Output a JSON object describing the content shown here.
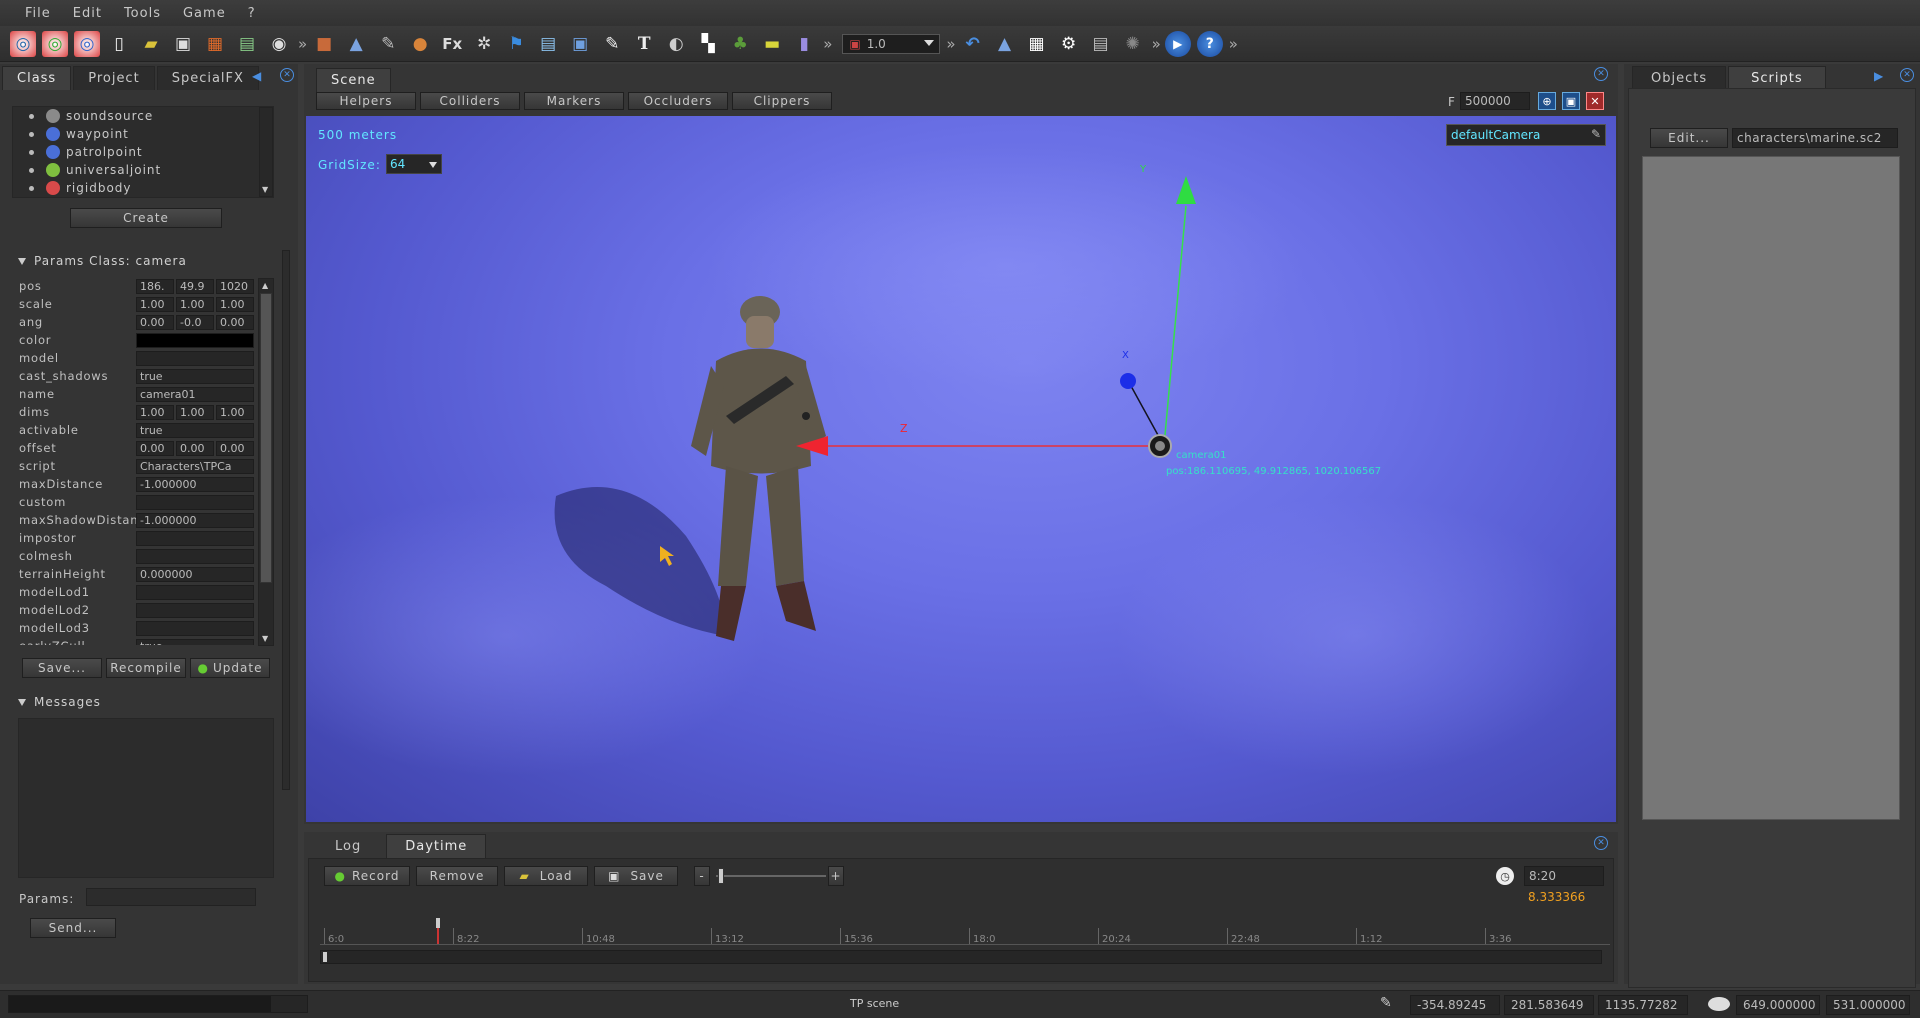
{
  "menu": [
    "File",
    "Edit",
    "Tools",
    "Game",
    "?"
  ],
  "toolbar": {
    "zoom_value": "1.0",
    "overflow": "»",
    "fx_label": "Fx",
    "text_tool": "T"
  },
  "left_panel": {
    "tabs": [
      "Class",
      "Project",
      "SpecialFX"
    ],
    "class_list": [
      {
        "label": "soundsource",
        "icon_color": "#8a8a8a"
      },
      {
        "label": "waypoint",
        "icon_color": "#4a6fd8"
      },
      {
        "label": "patrolpoint",
        "icon_color": "#4a6fd8"
      },
      {
        "label": "universaljoint",
        "icon_color": "#7fbf3f"
      },
      {
        "label": "rigidbody",
        "icon_color": "#d84a4a"
      }
    ],
    "create_label": "Create",
    "params_title": "Params Class:  camera",
    "params": [
      {
        "name": "pos",
        "v3": [
          "186.",
          "49.9",
          "1020"
        ]
      },
      {
        "name": "scale",
        "v3": [
          "1.00",
          "1.00",
          "1.00"
        ]
      },
      {
        "name": "ang",
        "v3": [
          "0.00",
          "-0.0",
          "0.00"
        ]
      },
      {
        "name": "color",
        "value": "",
        "black": true
      },
      {
        "name": "model",
        "value": ""
      },
      {
        "name": "cast_shadows",
        "value": "true"
      },
      {
        "name": "name",
        "value": "camera01"
      },
      {
        "name": "dims",
        "v3": [
          "1.00",
          "1.00",
          "1.00"
        ]
      },
      {
        "name": "activable",
        "value": "true"
      },
      {
        "name": "offset",
        "v3": [
          "0.00",
          "0.00",
          "0.00"
        ]
      },
      {
        "name": "script",
        "value": "Characters\\TPCa"
      },
      {
        "name": "maxDistance",
        "value": "-1.000000"
      },
      {
        "name": "custom",
        "value": ""
      },
      {
        "name": "maxShadowDistan",
        "value": "-1.000000"
      },
      {
        "name": "impostor",
        "value": ""
      },
      {
        "name": "colmesh",
        "value": ""
      },
      {
        "name": "terrainHeight",
        "value": "0.000000"
      },
      {
        "name": "modelLod1",
        "value": ""
      },
      {
        "name": "modelLod2",
        "value": ""
      },
      {
        "name": "modelLod3",
        "value": ""
      },
      {
        "name": "earlyZCull",
        "value": "true"
      }
    ],
    "save_label": "Save...",
    "recompile_label": "Recompile",
    "update_label": "Update",
    "messages_title": "Messages",
    "params_label": "Params:",
    "send_label": "Send..."
  },
  "scene": {
    "tab": "Scene",
    "filters": [
      "Helpers",
      "Colliders",
      "Markers",
      "Occluders",
      "Clippers"
    ],
    "f_label": "F",
    "f_value": "500000",
    "distance": "500 meters",
    "gridsize_label": "GridSize:",
    "gridsize_value": "64",
    "camera_select": "defaultCamera",
    "axis_y": "Y",
    "axis_z": "Z",
    "axis_x": "X",
    "object_name": "camera01",
    "object_pos": "pos:186.110695, 49.912865, 1020.106567"
  },
  "right_panel": {
    "tabs": [
      "Objects",
      "Scripts"
    ],
    "edit_label": "Edit...",
    "script_path": "characters\\marine.sc2"
  },
  "bottom_panel": {
    "tabs": [
      "Log",
      "Daytime"
    ],
    "record_label": "Record",
    "remove_label": "Remove",
    "load_label": "Load",
    "save_label": "Save",
    "minus": "-",
    "plus": "+",
    "time_value": "8:20",
    "time_decimal": "8.333366",
    "timeline_ticks": [
      "6:0",
      "8:22",
      "10:48",
      "13:12",
      "15:36",
      "18:0",
      "20:24",
      "22:48",
      "1:12",
      "3:36"
    ],
    "daytime_fraction": 0.09
  },
  "statusbar": {
    "scene_name": "TP scene",
    "x": "-354.89245",
    "y": "281.583649",
    "z": "1135.77282",
    "w": "649.000000",
    "h": "531.000000"
  }
}
